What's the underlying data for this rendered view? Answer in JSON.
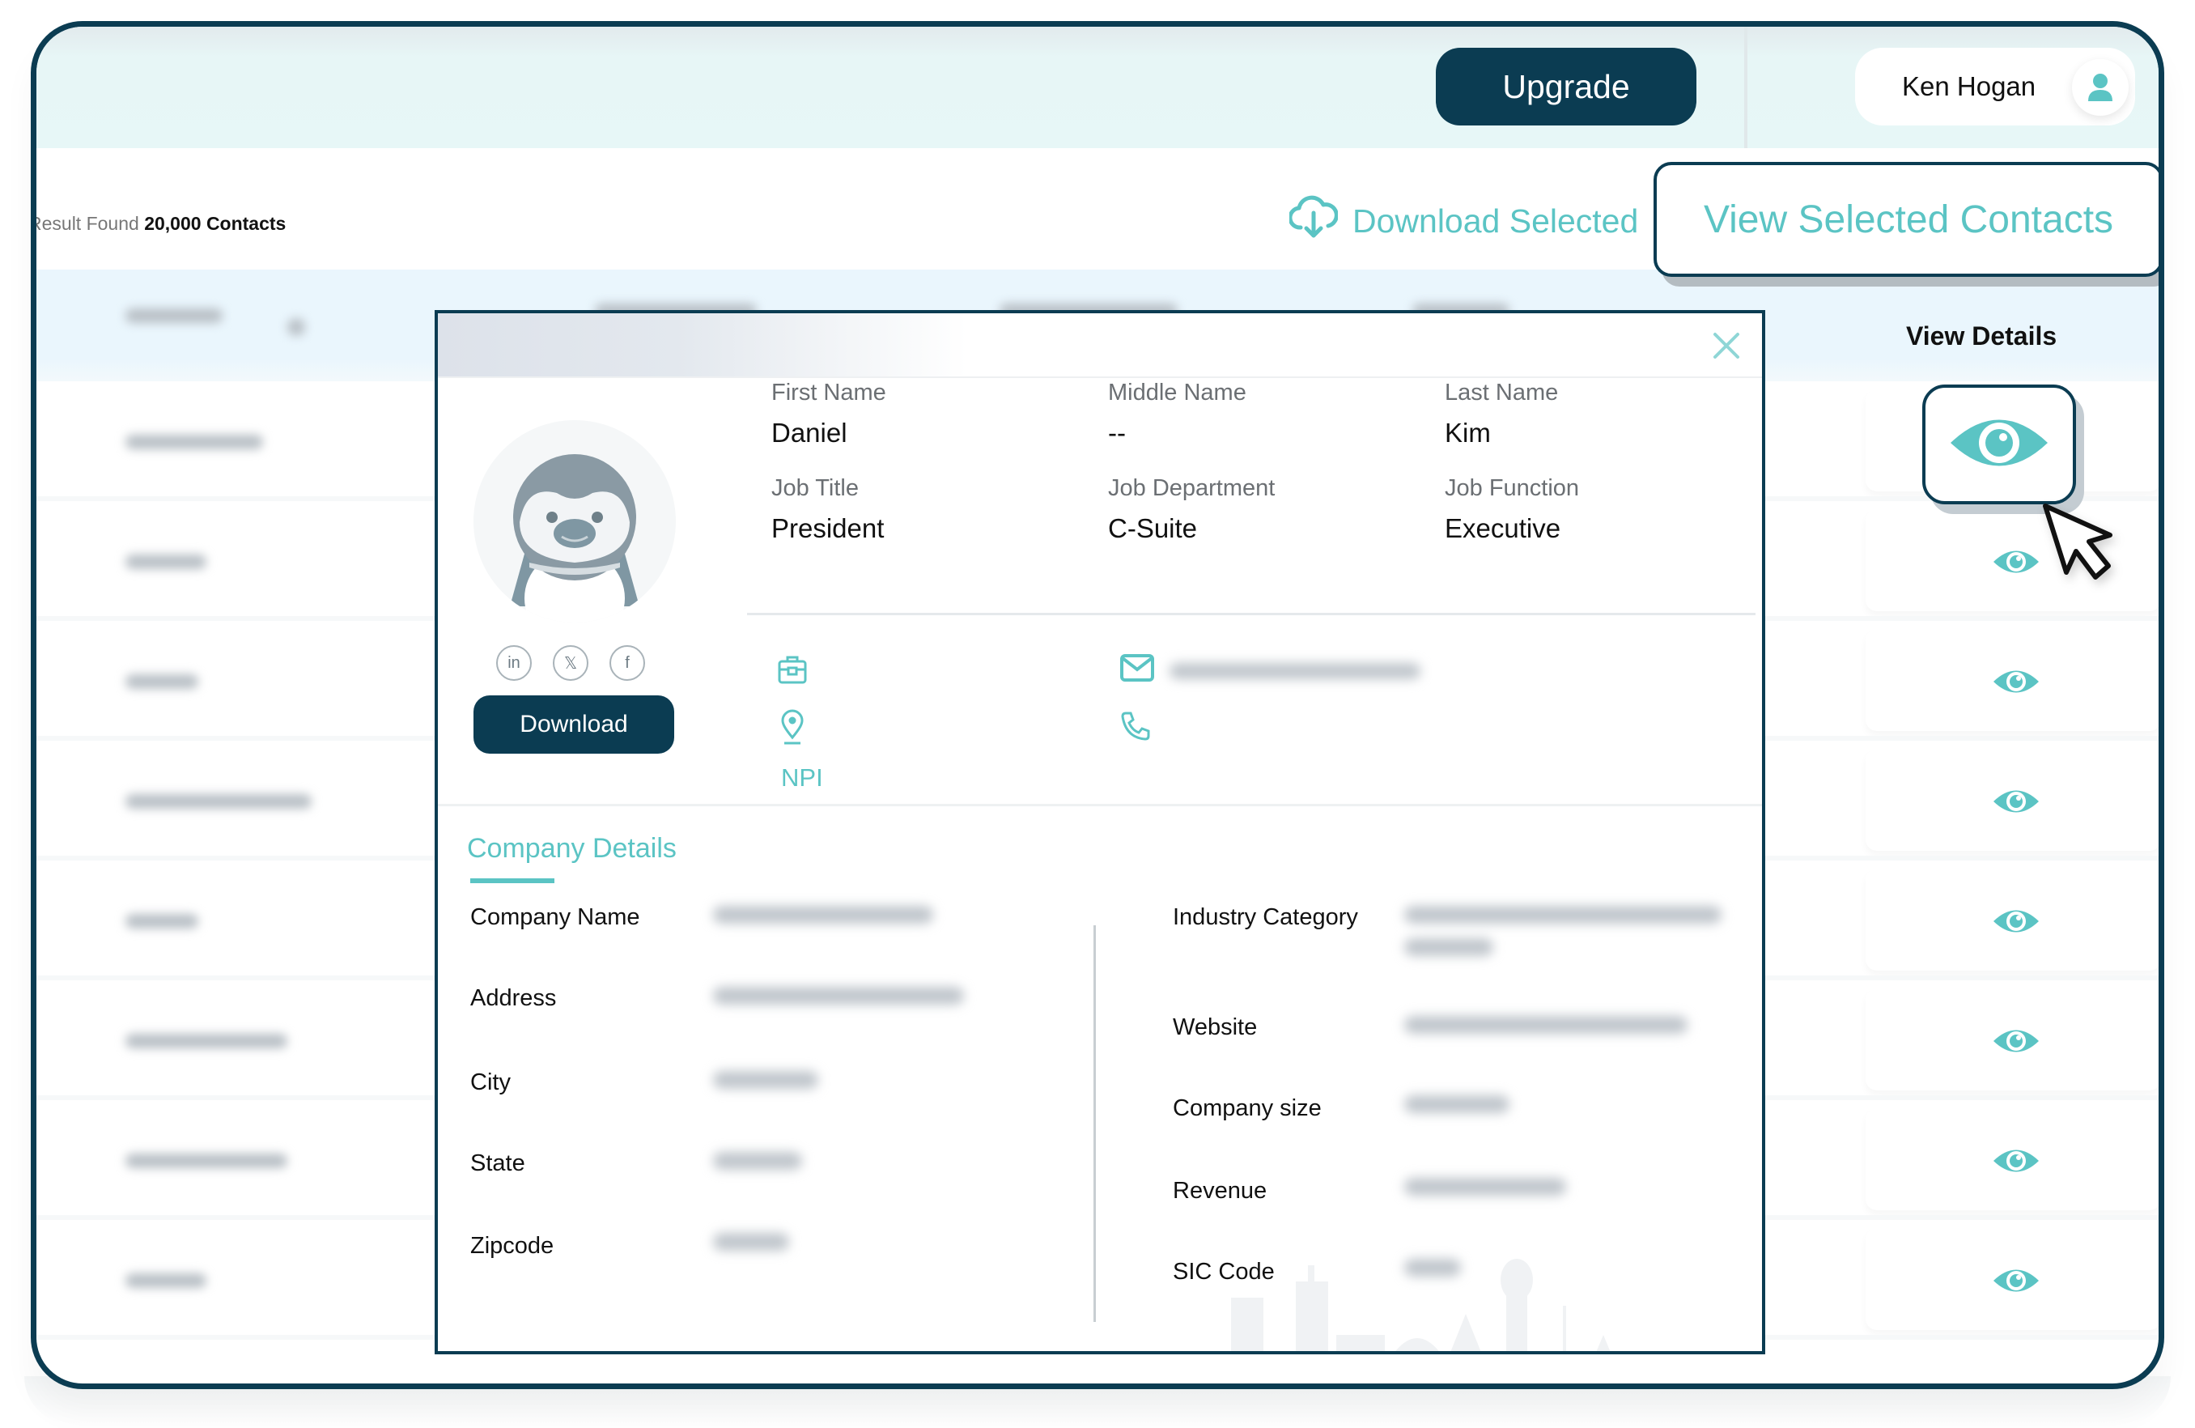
{
  "header": {
    "upgrade_label": "Upgrade",
    "user_name": "Ken Hogan",
    "user_icon": "user-icon"
  },
  "results": {
    "prefix": "Result Found",
    "count_label": "20,000 Contacts"
  },
  "actions": {
    "download_selected_label": "Download Selected",
    "download_selected_icon": "cloud-download-icon",
    "view_selected_label": "View Selected Contacts"
  },
  "table": {
    "view_details_header": "View Details",
    "row_count": 8,
    "row_icon": "eye-icon"
  },
  "modal": {
    "close_icon": "close-icon",
    "avatar_icon": "penguin-avatar",
    "socials": [
      {
        "name": "linkedin",
        "glyph": "in"
      },
      {
        "name": "x-twitter",
        "glyph": "𝕏"
      },
      {
        "name": "facebook",
        "glyph": "f"
      }
    ],
    "download_label": "Download",
    "fields": [
      {
        "label": "First Name",
        "value": "Daniel"
      },
      {
        "label": "Middle Name",
        "value": "--"
      },
      {
        "label": "Last Name",
        "value": "Kim"
      },
      {
        "label": "Job Title",
        "value": "President"
      },
      {
        "label": "Job Department",
        "value": "C-Suite"
      },
      {
        "label": "Job Function",
        "value": "Executive"
      }
    ],
    "contact_icons": [
      "briefcase-icon",
      "location-pin-icon",
      "email-icon",
      "phone-icon"
    ],
    "npi_label": "NPI",
    "company_section_title": "Company Details",
    "company_left": [
      {
        "label": "Company Name"
      },
      {
        "label": "Address"
      },
      {
        "label": "City"
      },
      {
        "label": "State"
      },
      {
        "label": "Zipcode"
      }
    ],
    "company_right": [
      {
        "label": "Industry Category"
      },
      {
        "label": "Website"
      },
      {
        "label": "Company size"
      },
      {
        "label": "Revenue"
      },
      {
        "label": "SIC Code"
      }
    ]
  },
  "colors": {
    "brand_dark": "#0b3c52",
    "accent_teal": "#5bc4c4",
    "header_bg": "#e7f7f7",
    "table_header_bg": "#eaf6fd"
  }
}
